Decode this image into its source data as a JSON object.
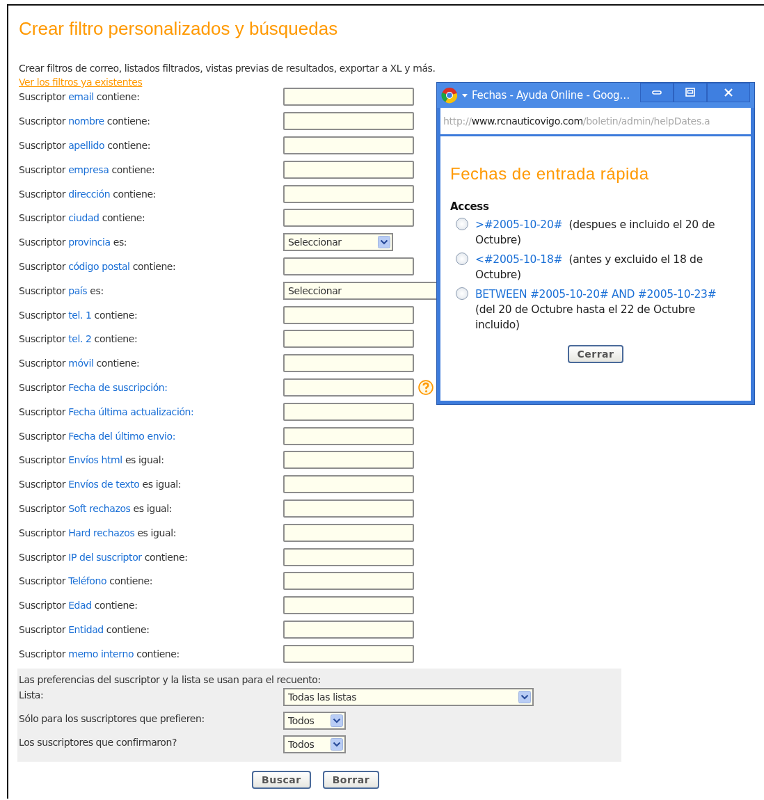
{
  "page": {
    "title": "Crear filtro personalizados y búsquedas",
    "description": "Crear filtros de correo, listados filtrados, vistas previas de resultados, exportar a XL y más.",
    "link": "Ver los filtros ya existentes"
  },
  "filters": [
    {
      "kind": "text",
      "prefix": "Suscriptor",
      "field": "email",
      "suffix": "contiene:"
    },
    {
      "kind": "text",
      "prefix": "Suscriptor",
      "field": "nombre",
      "suffix": "contiene:"
    },
    {
      "kind": "text",
      "prefix": "Suscriptor",
      "field": "apellido",
      "suffix": "contiene:"
    },
    {
      "kind": "text",
      "prefix": "Suscriptor",
      "field": "empresa",
      "suffix": "contiene:"
    },
    {
      "kind": "text",
      "prefix": "Suscriptor",
      "field": "dirección",
      "suffix": "contiene:"
    },
    {
      "kind": "text",
      "prefix": "Suscriptor",
      "field": "ciudad",
      "suffix": "contiene:"
    },
    {
      "kind": "select",
      "prefix": "Suscriptor",
      "field": "provincia",
      "suffix": "es:",
      "value": "Seleccionar"
    },
    {
      "kind": "text",
      "prefix": "Suscriptor",
      "field": "código postal",
      "suffix": "contiene:"
    },
    {
      "kind": "select_wide",
      "prefix": "Suscriptor",
      "field": "país",
      "suffix": "es:",
      "value": "Seleccionar"
    },
    {
      "kind": "text",
      "prefix": "Suscriptor",
      "field": "tel. 1",
      "suffix": "contiene:"
    },
    {
      "kind": "text",
      "prefix": "Suscriptor",
      "field": "tel. 2",
      "suffix": "contiene:"
    },
    {
      "kind": "text",
      "prefix": "Suscriptor",
      "field": "móvil",
      "suffix": "contiene:"
    },
    {
      "kind": "help_text",
      "prefix": "Suscriptor",
      "field": "Fecha de suscripción:"
    },
    {
      "kind": "text",
      "prefix": "Suscriptor",
      "field": "Fecha última actualización:"
    },
    {
      "kind": "text",
      "prefix": "Suscriptor",
      "field": "Fecha del último envio:"
    },
    {
      "kind": "text",
      "prefix": "Suscriptor",
      "field": "Envíos html",
      "suffix": "es igual:"
    },
    {
      "kind": "text",
      "prefix": "Suscriptor",
      "field": "Envíos de texto",
      "suffix": "es igual:"
    },
    {
      "kind": "text",
      "prefix": "Suscriptor",
      "field": "Soft rechazos",
      "suffix": "es igual:"
    },
    {
      "kind": "text",
      "prefix": "Suscriptor",
      "field": "Hard rechazos",
      "suffix": "es igual:"
    },
    {
      "kind": "text",
      "prefix": "Suscriptor",
      "field": "IP del suscriptor",
      "suffix": "contiene:"
    },
    {
      "kind": "text",
      "prefix": "Suscriptor",
      "field": "Teléfono",
      "suffix": "contiene:"
    },
    {
      "kind": "text",
      "prefix": "Suscriptor",
      "field": "Edad",
      "suffix": "contiene:"
    },
    {
      "kind": "text",
      "prefix": "Suscriptor",
      "field": "Entidad",
      "suffix": "contiene:"
    },
    {
      "kind": "text",
      "prefix": "Suscriptor",
      "field": "memo interno",
      "suffix": "contiene:"
    }
  ],
  "counting": {
    "note": "Las preferencias del suscriptor y la lista se usan para el recuento:",
    "rows": [
      {
        "label": "Lista:",
        "value": "Todas las listas",
        "kind": "wide"
      },
      {
        "label": "Sólo para los suscriptores que prefieren:",
        "value": "Todos",
        "kind": "short"
      },
      {
        "label": "Los suscriptores que confirmaron?",
        "value": "Todos",
        "kind": "short"
      }
    ]
  },
  "buttons": [
    {
      "label": "Buscar"
    },
    {
      "label": "Borrar"
    }
  ],
  "popup": {
    "title": "Fechas - Ayuda Online - Goog…",
    "url": {
      "scheme": "http://",
      "host": "www.rcnauticovigo.com",
      "path": "/boletin/admin/helpDates.a"
    },
    "heading": "Fechas de entrada rápida",
    "section": "Access",
    "options": [
      {
        "code": ">#2005-10-20#",
        "description": "(despues e incluido el 20 de Octubre)",
        "selected": false
      },
      {
        "code": "<#2005-10-18#",
        "description": "(antes y excluido el 18 de Octubre)",
        "selected": false
      },
      {
        "code": "BETWEEN #2005-10-20# AND #2005-10-23#",
        "description": "(del 20 de Octubre hasta el 22 de Octubre incluido)",
        "selected": false
      }
    ],
    "close_button": "Cerrar"
  }
}
